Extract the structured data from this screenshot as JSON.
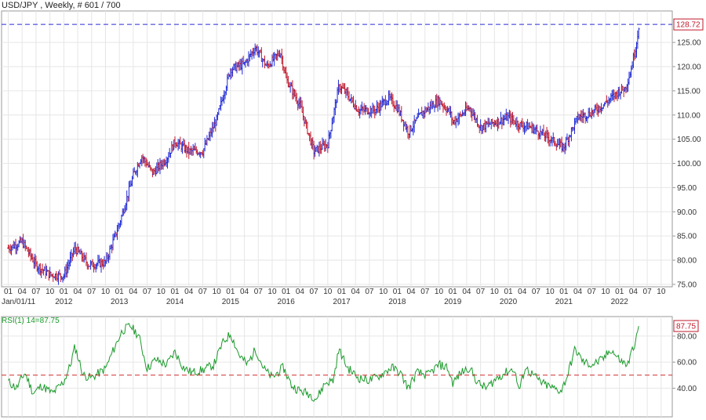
{
  "header": {
    "title": "USD/JPY , Weekly, # 601 / 700"
  },
  "colors": {
    "up_bar": "#1f2ad6",
    "down_bar": "#c0182a",
    "rsi_line": "#1a9a2a",
    "ref_line_price": "#2b2bd8",
    "ref_line_rsi": "#d02a2a",
    "grid": "#e6e6e6",
    "axis": "#999999"
  },
  "chart_data": [
    {
      "type": "line",
      "subtype": "ohlc-bars",
      "title": "USD/JPY , Weekly, # 601 / 700",
      "x_tick_months": [
        "01",
        "04",
        "07",
        "10",
        "01",
        "04",
        "07",
        "10",
        "01",
        "04",
        "07",
        "10",
        "01",
        "04",
        "07",
        "10",
        "01",
        "04",
        "07",
        "10",
        "01",
        "04",
        "07",
        "10",
        "01",
        "04",
        "07",
        "10",
        "01",
        "04",
        "07",
        "10",
        "01",
        "04",
        "07",
        "10",
        "01",
        "04",
        "07",
        "10",
        "01",
        "04",
        "07",
        "10",
        "01",
        "04",
        "07",
        "10"
      ],
      "x_tick_years": [
        "Jan/01/11",
        "2012",
        "2013",
        "2014",
        "2015",
        "2016",
        "2017",
        "2018",
        "2019",
        "2020",
        "2021",
        "2022"
      ],
      "y_ticks": [
        "75.00",
        "80.00",
        "85.00",
        "90.00",
        "95.00",
        "100.00",
        "105.00",
        "110.00",
        "115.00",
        "120.00",
        "125.00"
      ],
      "ylim": [
        74.5,
        131.5
      ],
      "grid": true,
      "last_value": "128.72",
      "series": [
        {
          "values": [
            [
              2011.0,
              82.5
            ],
            [
              2011.25,
              83.8
            ],
            [
              2011.5,
              79.0
            ],
            [
              2011.75,
              77.0
            ],
            [
              2012.0,
              76.8
            ],
            [
              2012.2,
              82.5
            ],
            [
              2012.45,
              79.0
            ],
            [
              2012.75,
              79.5
            ],
            [
              2013.0,
              87.5
            ],
            [
              2013.25,
              97.5
            ],
            [
              2013.4,
              101.5
            ],
            [
              2013.6,
              98.0
            ],
            [
              2013.85,
              101.0
            ],
            [
              2014.0,
              104.5
            ],
            [
              2014.25,
              102.5
            ],
            [
              2014.5,
              102.5
            ],
            [
              2014.75,
              109.0
            ],
            [
              2015.0,
              119.5
            ],
            [
              2015.25,
              120.5
            ],
            [
              2015.45,
              124.0
            ],
            [
              2015.65,
              120.0
            ],
            [
              2015.9,
              123.0
            ],
            [
              2016.0,
              117.5
            ],
            [
              2016.25,
              112.0
            ],
            [
              2016.5,
              102.5
            ],
            [
              2016.75,
              104.0
            ],
            [
              2016.95,
              116.0
            ],
            [
              2017.05,
              115.0
            ],
            [
              2017.3,
              111.0
            ],
            [
              2017.6,
              111.0
            ],
            [
              2017.85,
              113.5
            ],
            [
              2018.0,
              111.5
            ],
            [
              2018.2,
              106.5
            ],
            [
              2018.45,
              110.5
            ],
            [
              2018.75,
              113.0
            ],
            [
              2018.95,
              110.5
            ],
            [
              2019.0,
              108.5
            ],
            [
              2019.3,
              111.5
            ],
            [
              2019.5,
              107.5
            ],
            [
              2019.75,
              108.5
            ],
            [
              2020.0,
              109.5
            ],
            [
              2020.2,
              108.0
            ],
            [
              2020.4,
              107.5
            ],
            [
              2020.7,
              105.5
            ],
            [
              2020.95,
              103.5
            ],
            [
              2021.0,
              103.5
            ],
            [
              2021.25,
              109.5
            ],
            [
              2021.5,
              110.5
            ],
            [
              2021.75,
              112.5
            ],
            [
              2022.0,
              115.0
            ],
            [
              2022.1,
              115.5
            ],
            [
              2022.2,
              119.0
            ],
            [
              2022.3,
              124.5
            ],
            [
              2022.35,
              128.7
            ]
          ]
        }
      ]
    },
    {
      "type": "line",
      "title": "RSI(1) 14=87.75",
      "y_ticks": [
        "40.00",
        "60.00",
        "80.00"
      ],
      "ylim": [
        18,
        95
      ],
      "reference_line": 50,
      "grid": true,
      "last_value": "87.75",
      "series": [
        {
          "values": [
            [
              2011.0,
              45
            ],
            [
              2011.15,
              40
            ],
            [
              2011.3,
              52
            ],
            [
              2011.45,
              36
            ],
            [
              2011.6,
              42
            ],
            [
              2011.8,
              36
            ],
            [
              2012.0,
              45
            ],
            [
              2012.12,
              58
            ],
            [
              2012.2,
              72
            ],
            [
              2012.35,
              50
            ],
            [
              2012.5,
              48
            ],
            [
              2012.75,
              55
            ],
            [
              2012.9,
              70
            ],
            [
              2013.05,
              84
            ],
            [
              2013.2,
              88
            ],
            [
              2013.35,
              80
            ],
            [
              2013.5,
              55
            ],
            [
              2013.65,
              62
            ],
            [
              2013.85,
              58
            ],
            [
              2014.0,
              68
            ],
            [
              2014.15,
              56
            ],
            [
              2014.3,
              52
            ],
            [
              2014.5,
              54
            ],
            [
              2014.7,
              58
            ],
            [
              2014.85,
              74
            ],
            [
              2015.0,
              82
            ],
            [
              2015.15,
              66
            ],
            [
              2015.3,
              58
            ],
            [
              2015.45,
              70
            ],
            [
              2015.6,
              55
            ],
            [
              2015.75,
              48
            ],
            [
              2015.95,
              56
            ],
            [
              2016.1,
              42
            ],
            [
              2016.25,
              38
            ],
            [
              2016.4,
              36
            ],
            [
              2016.55,
              32
            ],
            [
              2016.7,
              44
            ],
            [
              2016.85,
              46
            ],
            [
              2016.95,
              70
            ],
            [
              2017.1,
              56
            ],
            [
              2017.3,
              48
            ],
            [
              2017.5,
              46
            ],
            [
              2017.7,
              50
            ],
            [
              2017.9,
              56
            ],
            [
              2018.05,
              52
            ],
            [
              2018.2,
              40
            ],
            [
              2018.35,
              52
            ],
            [
              2018.55,
              50
            ],
            [
              2018.75,
              58
            ],
            [
              2018.9,
              56
            ],
            [
              2019.0,
              44
            ],
            [
              2019.15,
              52
            ],
            [
              2019.3,
              56
            ],
            [
              2019.45,
              44
            ],
            [
              2019.6,
              40
            ],
            [
              2019.8,
              48
            ],
            [
              2019.95,
              52
            ],
            [
              2020.1,
              55
            ],
            [
              2020.2,
              38
            ],
            [
              2020.3,
              56
            ],
            [
              2020.45,
              50
            ],
            [
              2020.6,
              44
            ],
            [
              2020.8,
              40
            ],
            [
              2020.95,
              38
            ],
            [
              2021.05,
              48
            ],
            [
              2021.2,
              70
            ],
            [
              2021.35,
              60
            ],
            [
              2021.5,
              58
            ],
            [
              2021.7,
              62
            ],
            [
              2021.85,
              70
            ],
            [
              2021.95,
              64
            ],
            [
              2022.05,
              60
            ],
            [
              2022.15,
              58
            ],
            [
              2022.25,
              72
            ],
            [
              2022.32,
              80
            ],
            [
              2022.35,
              87.75
            ]
          ]
        }
      ]
    }
  ]
}
